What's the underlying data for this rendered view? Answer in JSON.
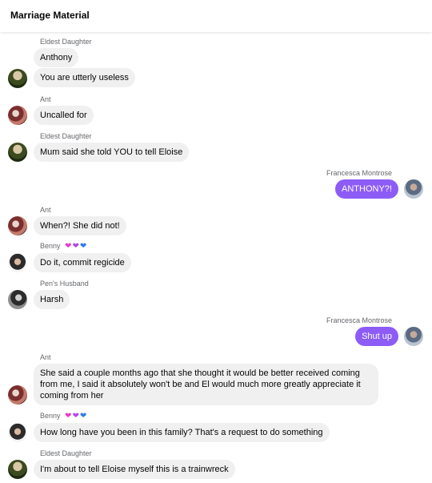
{
  "header": {
    "title": "Marriage Material"
  },
  "theme": {
    "outgoing_bubble_color": "#8d5cf6",
    "incoming_bubble_color": "#f0f0f0"
  },
  "messages": [
    {
      "sender": "Eldest Daughter",
      "text": "Anthony",
      "direction": "incoming"
    },
    {
      "sender": "Eldest Daughter",
      "text": "You are utterly useless",
      "direction": "incoming"
    },
    {
      "sender": "Ant",
      "text": "Uncalled for",
      "direction": "incoming"
    },
    {
      "sender": "Eldest Daughter",
      "text": "Mum said she told YOU to tell Eloise",
      "direction": "incoming"
    },
    {
      "sender": "Francesca Montrose",
      "text": "ANTHONY?!",
      "direction": "outgoing"
    },
    {
      "sender": "Ant",
      "text": "When?! She did not!",
      "direction": "incoming"
    },
    {
      "sender": "Benny",
      "sender_icons": [
        "pink-heart-icon",
        "purple-heart-icon",
        "blue-heart-icon"
      ],
      "text": "Do it, commit regicide",
      "direction": "incoming"
    },
    {
      "sender": "Pen's Husband",
      "text": "Harsh",
      "direction": "incoming"
    },
    {
      "sender": "Francesca Montrose",
      "text": "Shut up",
      "direction": "outgoing"
    },
    {
      "sender": "Ant",
      "text": "She said a couple months ago that she thought it would be better received coming from me, I said it absolutely won't be and El would much more greatly appreciate it coming from her",
      "direction": "incoming"
    },
    {
      "sender": "Benny",
      "sender_icons": [
        "pink-heart-icon",
        "purple-heart-icon",
        "blue-heart-icon"
      ],
      "text": "How long have you been in this family? That's a request to do something",
      "direction": "incoming"
    },
    {
      "sender": "Eldest Daughter",
      "text": "I'm about to tell Eloise myself this is a trainwreck",
      "direction": "incoming"
    }
  ]
}
